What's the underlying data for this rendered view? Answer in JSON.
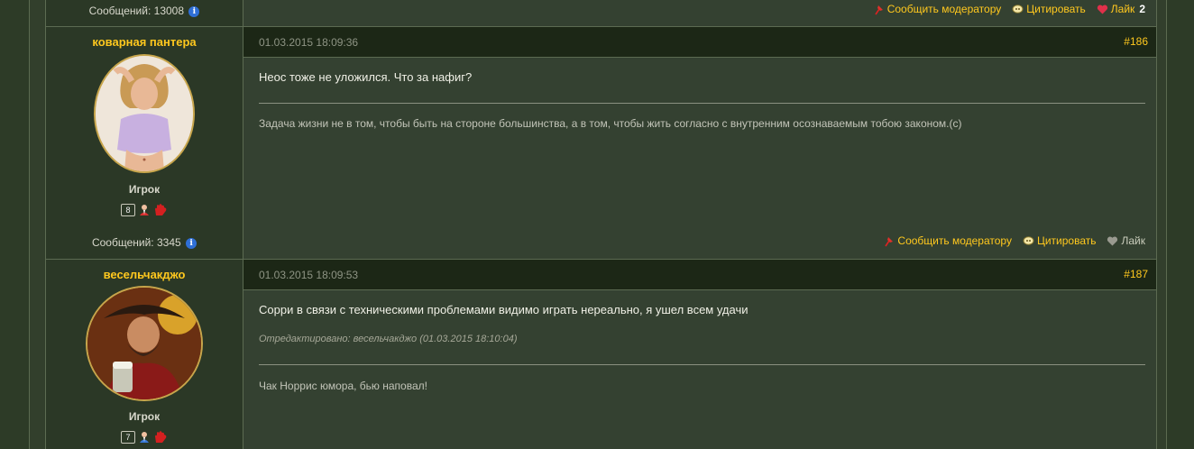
{
  "top_row": {
    "messages_label": "Сообщений:",
    "messages_count": "13008",
    "actions": {
      "report": "Сообщить модератору",
      "quote": "Цитировать",
      "like": "Лайк",
      "like_count": "2"
    }
  },
  "posts": [
    {
      "author": "коварная пантера",
      "role": "Игрок",
      "reputation": "8",
      "messages_label": "Сообщений:",
      "messages_count": "3345",
      "date": "01.03.2015 18:09:36",
      "number": "#186",
      "text": "Неос тоже не уложился. Что за нафиг?",
      "signature": "Задача жизни не в том, чтобы быть на стороне большинства, а в том, чтобы жить согласно с внутренним  осознаваемым тобою законом.(с)",
      "actions": {
        "report": "Сообщить модератору",
        "quote": "Цитировать",
        "like": "Лайк"
      }
    },
    {
      "author": "весельчакджо",
      "role": "Игрок",
      "reputation": "7",
      "date": "01.03.2015 18:09:53",
      "number": "#187",
      "text": "Сорри в связи с техническими проблемами видимо играть нереально, я ушел всем удачи",
      "edited": "Отредактировано: весельчакджо (01.03.2015 18:10:04)",
      "signature": "Чак Норрис юмора, бью наповал!"
    }
  ],
  "colors": {
    "accent": "#ffc81e",
    "background": "#2d3b27",
    "header": "#1c2716"
  },
  "icons": [
    "info-icon",
    "report-pin-icon",
    "quote-bubble-icon",
    "heart-icon",
    "user-icon",
    "hand-icon"
  ]
}
